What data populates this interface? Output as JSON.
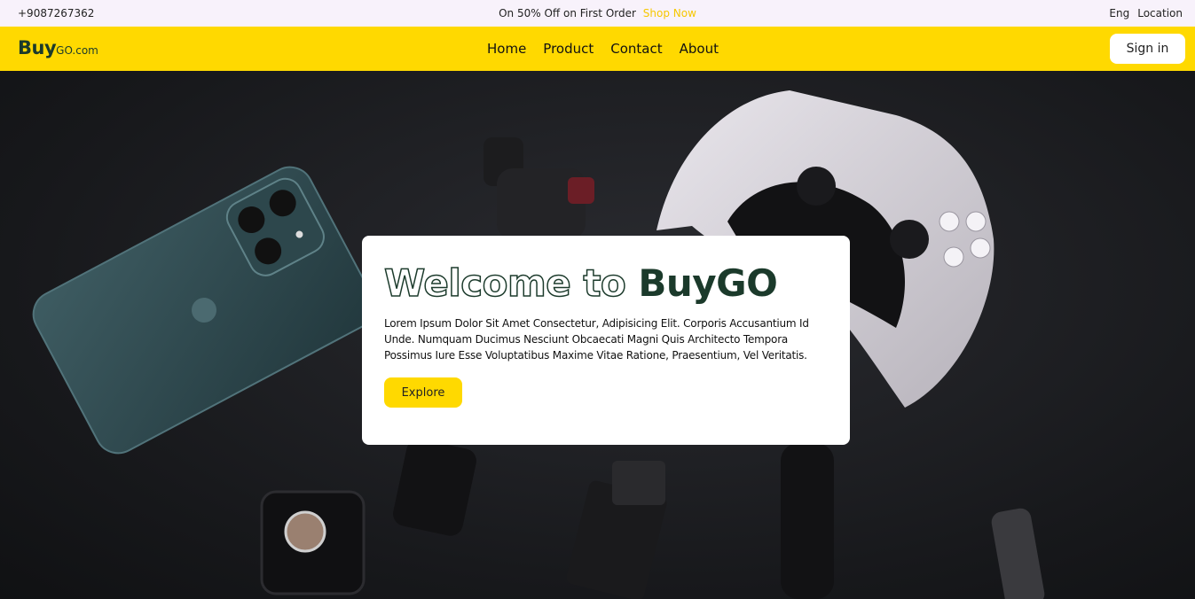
{
  "topbar": {
    "phone": "+9087267362",
    "promo_text": "On 50% Off on First Order",
    "promo_link": "Shop Now",
    "language": "Eng",
    "location": "Location"
  },
  "navbar": {
    "logo_main": "Buy",
    "logo_suffix": "GO.com",
    "links": [
      "Home",
      "Product",
      "Contact",
      "About"
    ],
    "signin_label": "Sign in"
  },
  "hero": {
    "title_outline": "Welcome to",
    "title_brand": "BuyGO",
    "description": "Lorem Ipsum Dolor Sit Amet Consectetur, Adipisicing Elit. Corporis Accusantium Id Unde. Numquam Ducimus Nesciunt Obcaecati Magni Quis Architecto Tempora Possimus Iure Esse Voluptatibus Maxime Vitae Ratione, Praesentium, Vel Veritatis.",
    "cta_label": "Explore"
  },
  "colors": {
    "accent": "#ffd900",
    "brand_text": "#1b3a2b",
    "topbar_bg": "#f8f2fb",
    "promo_link": "#f6c700"
  },
  "icons": {
    "background_image": "tech-gadgets-photo"
  }
}
